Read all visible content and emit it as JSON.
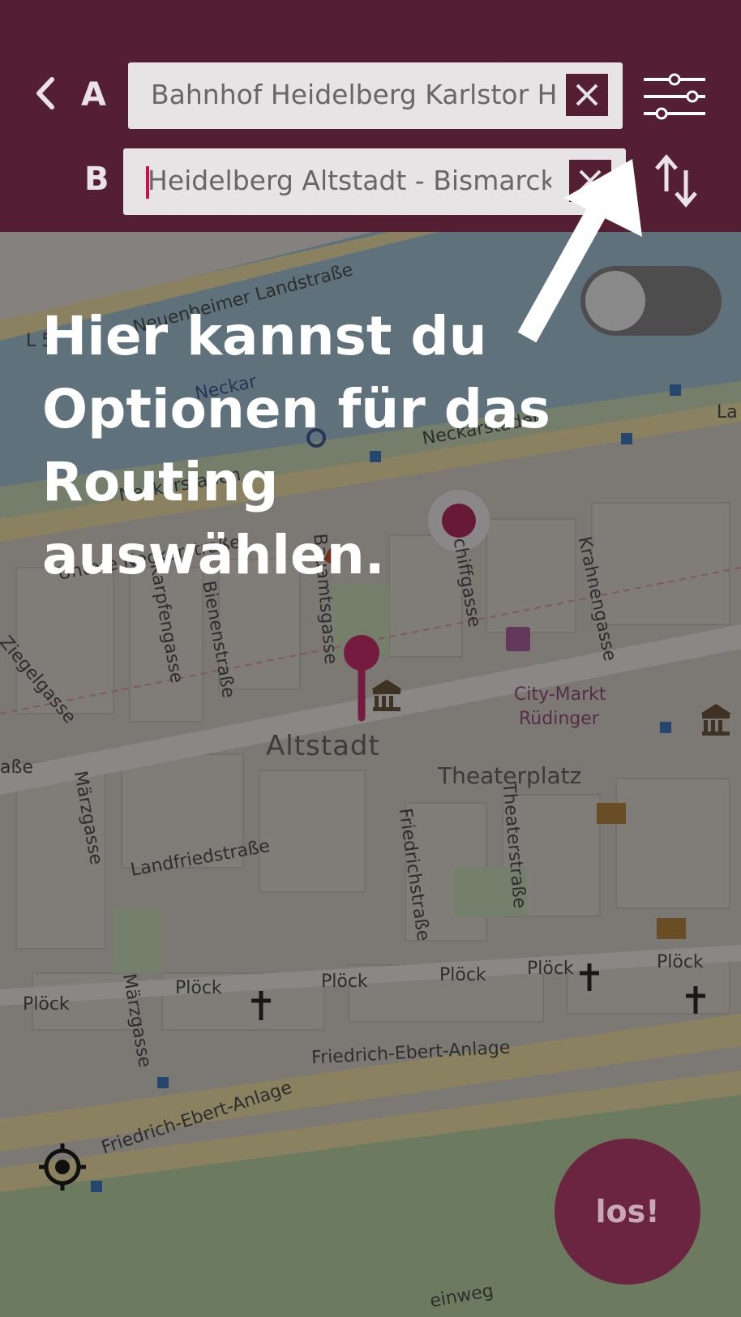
{
  "header": {
    "back_icon": "chevron-left-icon",
    "start_letter": "A",
    "start_value": "Bahnhof Heidelberg Karlstor He",
    "destination_letter": "B",
    "destination_value": "Heidelberg Altstadt - Bismarckpla",
    "options_icon": "sliders-icon",
    "swap_icon": "swap-vertical-icon",
    "clear_icon": "close-icon"
  },
  "tutorial": {
    "text": "Hier kannst du Optionen für das Routing auswählen.",
    "arrow_icon": "arrow-up-right-icon"
  },
  "map": {
    "labels": {
      "neuenheimer": "Neuenheimer Landstraße",
      "neckarstaden_1": "Neckarstaden",
      "neckarstaden_2": "Neckarstaden",
      "neckar_partial": "Neckar",
      "untere_neckarstrasse": "Untere Neckarstraße",
      "karpfengasse": "Karpfengasse",
      "bienenstrasse": "Bienenstraße",
      "bauamtsgasse": "Bauamtsgasse",
      "schiffgasse": "chiffgasse",
      "krahnengasse": "Krahnengasse",
      "ziegelgasse": "Ziegelgasse",
      "altstadt": "Altstadt",
      "city_markt": "City-Markt",
      "ruediger": "Rüdinger",
      "theaterplatz": "Theaterplatz",
      "theaterstrasse": "Theaterstraße",
      "friedrichstrasse": "Friedrichstraße",
      "maerzgasse_1": "Märzgasse",
      "maerzgasse_2": "Märzgasse",
      "landfriedstrasse": "Landfriedstraße",
      "ploeck_1": "Plöck",
      "ploeck_2": "Plöck",
      "ploeck_3": "Plöck",
      "ploeck_4": "Plöck",
      "ploeck_5": "Plöck",
      "ploeck_6": "Plöck",
      "friedrich_ebert_1": "Friedrich-Ebert-Anlage",
      "friedrich_ebert_2": "Friedrich-Ebert-Anlage",
      "strasse_partial": "aße",
      "la_partial": "La",
      "l5_partial": "L 5",
      "einweg_partial": "einweg"
    },
    "toggle_state": "off"
  },
  "go_button": {
    "label": "los!"
  },
  "locate_icon": "crosshair-icon",
  "colors": {
    "header": "#541f33",
    "accent": "#b0124a",
    "field_bg": "#e7e4e5"
  }
}
